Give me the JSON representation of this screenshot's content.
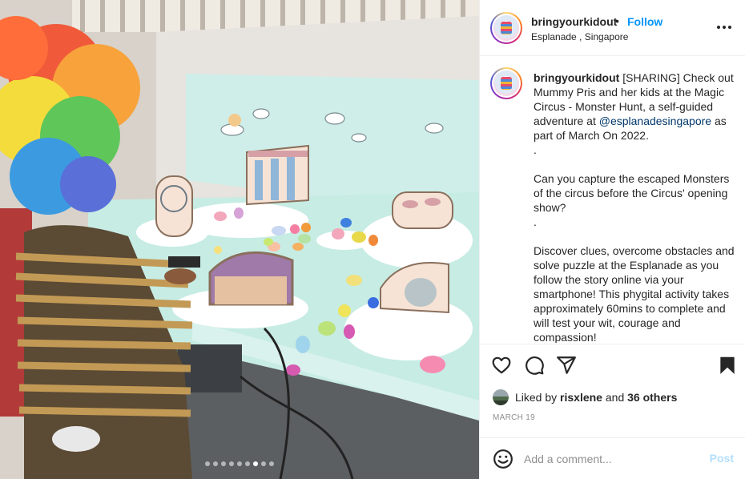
{
  "post": {
    "image_alt_subject": "",
    "carousel_dots": 9,
    "carousel_active_index": 6
  },
  "header": {
    "username": "bringyourkidout",
    "bullet": "•",
    "follow_label": "Follow",
    "location": "Esplanade , Singapore"
  },
  "caption": {
    "username": "bringyourkidout",
    "text_before_mention": " [SHARING] Check out Mummy Pris and her kids at the Magic Circus - Monster Hunt, a self-guided adventure at ",
    "mention": "@esplanadesingapore",
    "text_after_mention": " as part of March On 2022.\n.\n\nCan you capture the escaped Monsters of the circus before the Circus' opening show?\n.\n\nDiscover clues, overcome obstacles and solve puzzle at the Esplanade as you follow the story online via your smartphone! This phygital activity takes approximately 60mins to complete and will test your wit, courage and compassion!"
  },
  "likes": {
    "prefix": "Liked by ",
    "user": "risxlene",
    "middle": " and ",
    "others": "36 others"
  },
  "date": "MARCH 19",
  "comment": {
    "placeholder": "Add a comment...",
    "post_label": "Post"
  },
  "colors": {
    "accent": "#0095f6",
    "mention": "#00376b",
    "post_disabled": "#b2dffc",
    "muted": "#8e8e8e"
  },
  "icons": [
    "more-options-icon",
    "heart-icon",
    "comment-icon",
    "share-icon",
    "bookmark-icon",
    "emoji-icon"
  ]
}
